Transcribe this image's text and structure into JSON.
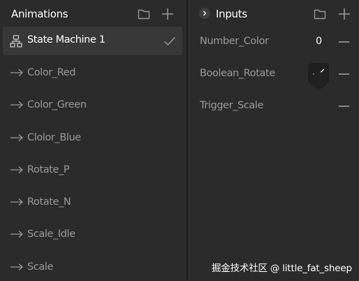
{
  "animations_panel": {
    "title": "Animations",
    "items": [
      {
        "label": "State Machine 1",
        "icon": "state-machine-icon",
        "selected": true
      },
      {
        "label": "Color_Red",
        "icon": "arrow-right-icon"
      },
      {
        "label": "Color_Green",
        "icon": "arrow-right-icon"
      },
      {
        "label": "Clolor_Blue",
        "icon": "arrow-right-icon"
      },
      {
        "label": "Rotate_P",
        "icon": "arrow-right-icon"
      },
      {
        "label": "Rotate_N",
        "icon": "arrow-right-icon"
      },
      {
        "label": "Scale_Idle",
        "icon": "arrow-right-icon"
      },
      {
        "label": "Scale",
        "icon": "arrow-right-icon"
      }
    ]
  },
  "inputs_panel": {
    "title": "Inputs",
    "inputs": [
      {
        "label": "Number_Color",
        "type": "number",
        "value": "0"
      },
      {
        "label": "Boolean_Rotate",
        "type": "boolean",
        "checked": true
      },
      {
        "label": "Trigger_Scale",
        "type": "trigger"
      }
    ]
  },
  "watermark": "掘金技术社区 @ little_fat_sheep",
  "colors": {
    "background": "#2b2b2b",
    "selected_row": "#383838",
    "text_primary": "#ffffff",
    "text_secondary": "#9a9a9a"
  }
}
